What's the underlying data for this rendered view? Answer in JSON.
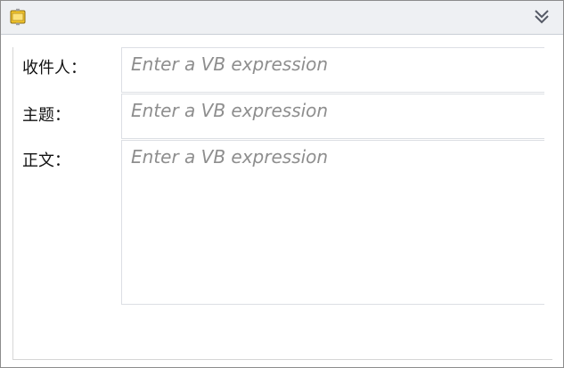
{
  "form": {
    "to_label": "收件人：",
    "to_placeholder": "Enter a VB expression",
    "subject_label": "主题：",
    "subject_placeholder": "Enter a VB expression",
    "body_label": "正文：",
    "body_placeholder": "Enter a VB expression"
  },
  "icons": {
    "activity_icon": "activity-icon",
    "collapse_icon": "chevron-double-down-icon"
  },
  "colors": {
    "header_bg": "#eef0f3",
    "placeholder": "#8e8e8e",
    "icon_yellow": "#f3c52b"
  }
}
